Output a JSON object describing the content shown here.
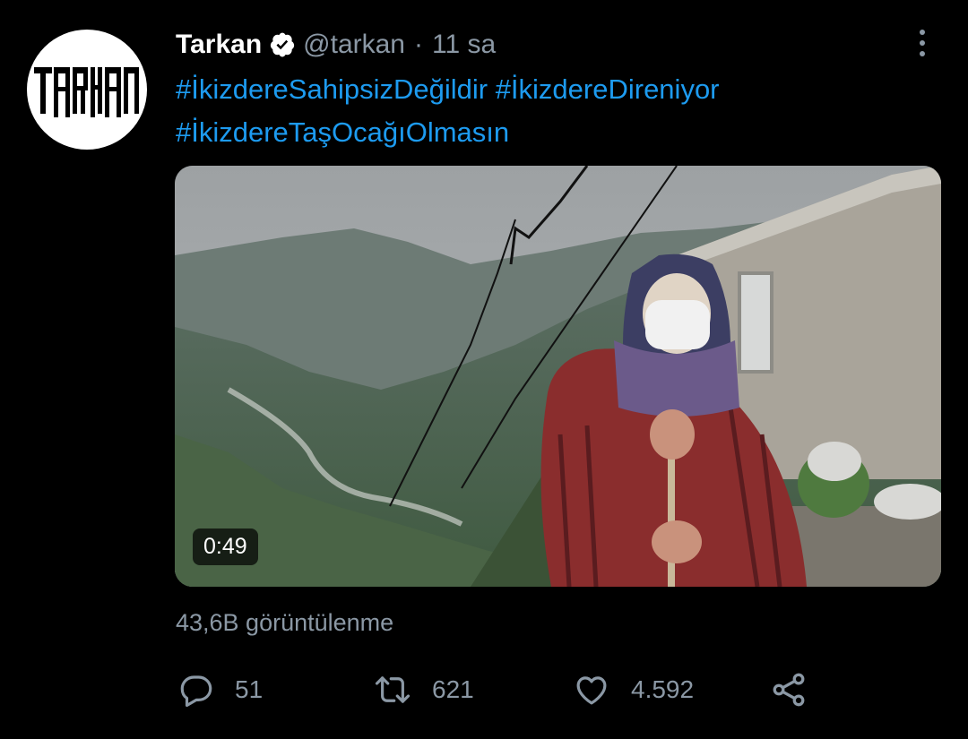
{
  "tweet": {
    "author": {
      "display_name": "Tarkan",
      "handle": "@tarkan",
      "verified": true,
      "avatar_text": "TARKAN"
    },
    "separator": "·",
    "time": "11 sa",
    "hashtags": [
      "#İkizdereSahipsizDeğildir",
      "#İkizdereDireniyor",
      "#İkizdereTaşOcağıOlmasın"
    ],
    "media": {
      "type": "video",
      "duration": "0:49"
    },
    "views": "43,6B görüntülenme",
    "actions": {
      "reply": {
        "icon": "reply-icon",
        "count": "51"
      },
      "retweet": {
        "icon": "retweet-icon",
        "count": "621"
      },
      "like": {
        "icon": "heart-icon",
        "count": "4.592"
      },
      "share": {
        "icon": "share-icon"
      }
    }
  },
  "colors": {
    "background": "#000000",
    "text": "#ffffff",
    "secondary": "#8b98a5",
    "hashtag": "#1d9bf0"
  }
}
